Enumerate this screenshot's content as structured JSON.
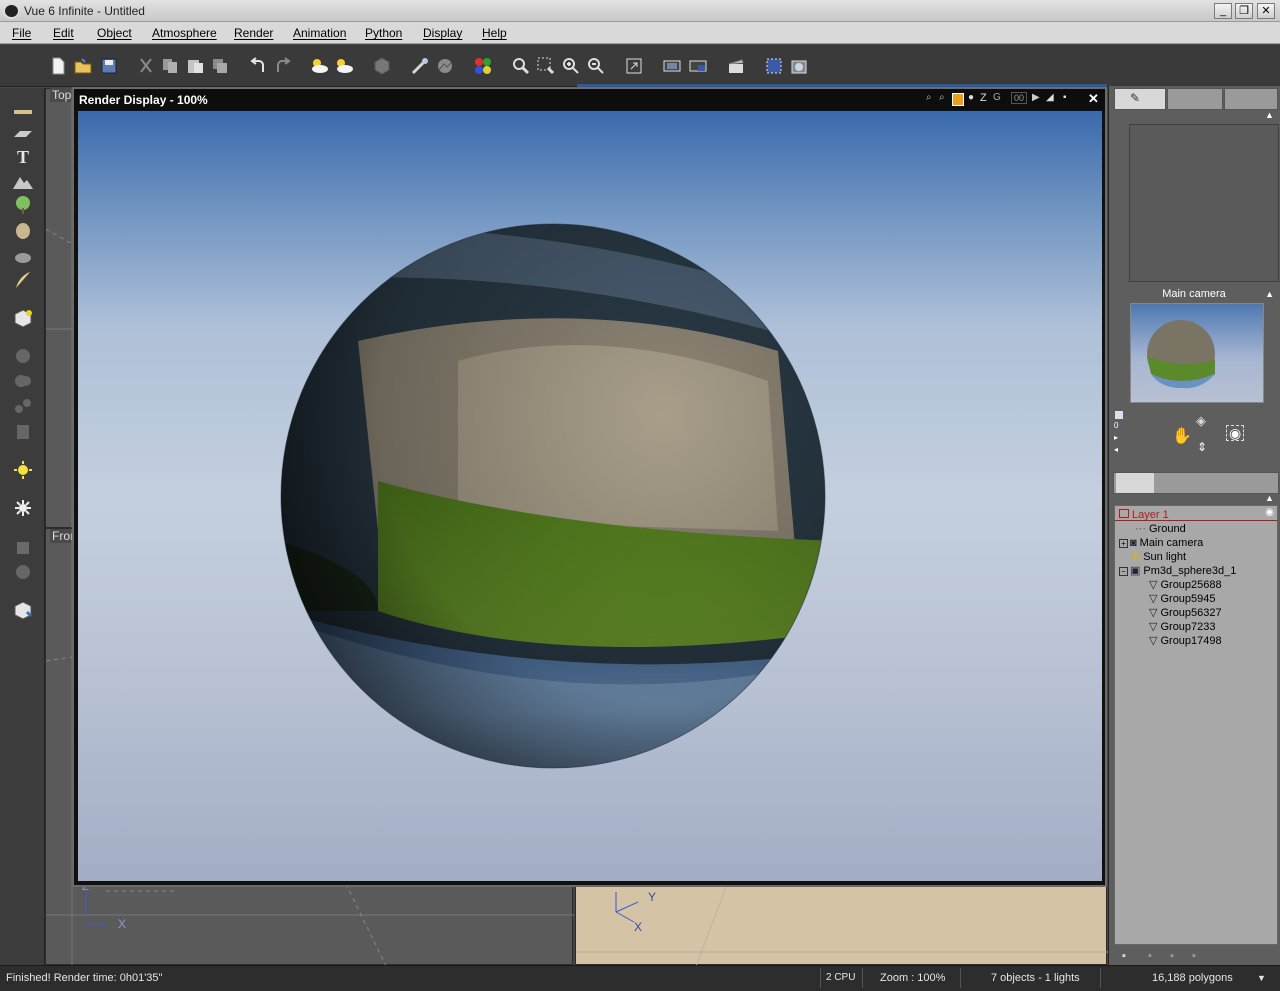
{
  "window": {
    "title": "Vue 6 Infinite - Untitled",
    "minimize_label": "_",
    "restore_label": "❐",
    "close_label": "✕"
  },
  "menu": [
    "File",
    "Edit",
    "Object",
    "Atmosphere",
    "Render",
    "Animation",
    "Python",
    "Display",
    "Help"
  ],
  "viewports": {
    "top_label": "Top",
    "front_label": "Fron",
    "axis_z": "Z",
    "axis_x": "X",
    "axis_y": "Y"
  },
  "render_display": {
    "title": "Render Display - 100%",
    "toolbar": {
      "zoom_in_glyph": "⌕",
      "z_label": "Z",
      "percent_label": "00",
      "close_glyph": "✕"
    }
  },
  "right_panel": {
    "camera_title": "Main camera",
    "nav_zero": "0"
  },
  "layers": [
    {
      "label": "Layer 1",
      "indent": 0,
      "kind": "layer"
    },
    {
      "label": "Ground",
      "indent": 1,
      "kind": "ground"
    },
    {
      "label": "Main camera",
      "indent": 1,
      "kind": "camera"
    },
    {
      "label": "Sun light",
      "indent": 1,
      "kind": "sun"
    },
    {
      "label": "Pm3d_sphere3d_1",
      "indent": 1,
      "kind": "group"
    },
    {
      "label": "Group25688",
      "indent": 2,
      "kind": "mesh"
    },
    {
      "label": "Group5945",
      "indent": 2,
      "kind": "mesh"
    },
    {
      "label": "Group56327",
      "indent": 2,
      "kind": "mesh"
    },
    {
      "label": "Group7233",
      "indent": 2,
      "kind": "mesh"
    },
    {
      "label": "Group17498",
      "indent": 2,
      "kind": "mesh"
    }
  ],
  "status": {
    "message": "Finished! Render time: 0h01'35\"",
    "cpu": "2 CPU",
    "zoom": "Zoom : 100%",
    "objects": "7 objects - 1 lights",
    "polygons": "16,188 polygons"
  },
  "colors": {
    "layer_accent": "#b31b1b",
    "sky_top": "#3a6aac",
    "sky_bottom": "#a3adc6"
  }
}
